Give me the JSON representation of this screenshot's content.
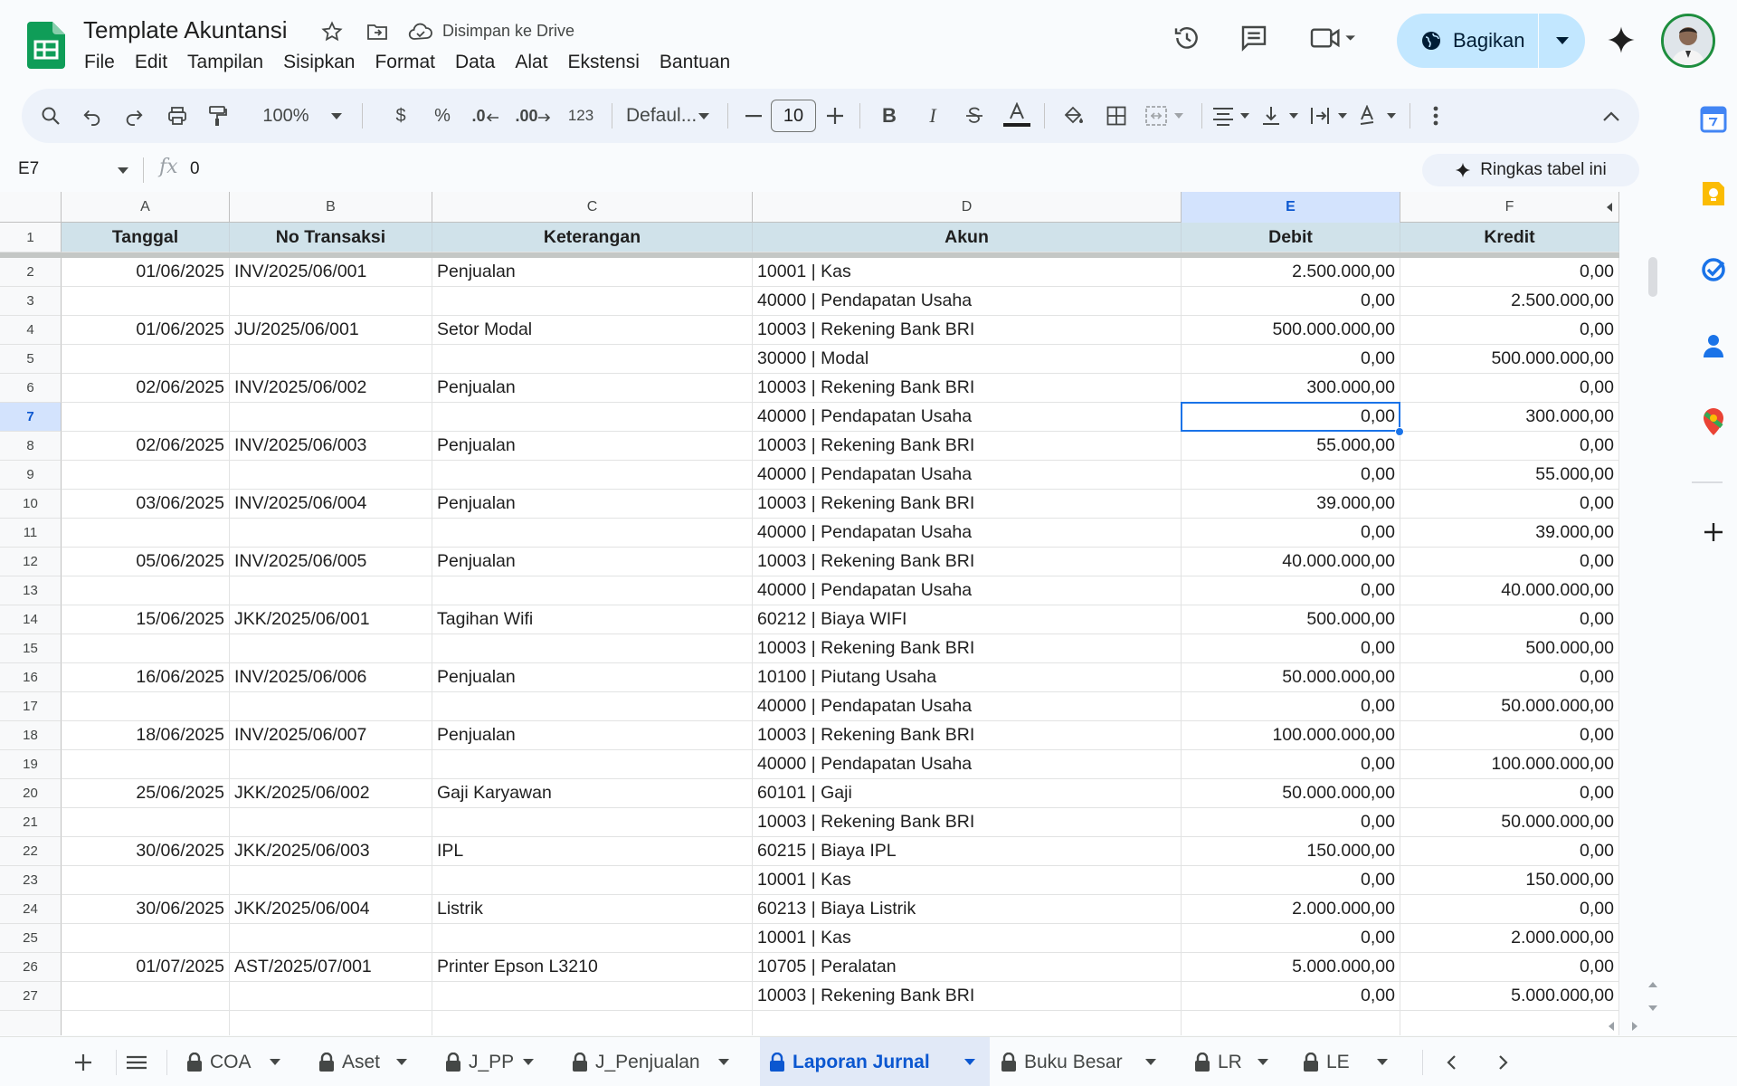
{
  "app": {
    "title": "Template Akuntansi",
    "saved_status": "Disimpan ke Drive",
    "menu": [
      "File",
      "Edit",
      "Tampilan",
      "Sisipkan",
      "Format",
      "Data",
      "Alat",
      "Ekstensi",
      "Bantuan"
    ],
    "share_label": "Bagikan"
  },
  "toolbar": {
    "zoom": "100%",
    "currency": "$",
    "percent": "%",
    "dec_decrease": ".0",
    "dec_increase": ".00",
    "number_format": "123",
    "font": "Defaul...",
    "font_size": "10"
  },
  "formula_bar": {
    "name_box": "E7",
    "fx": "fx",
    "value": "0",
    "summarize_label": "Ringkas tabel ini"
  },
  "grid": {
    "columns": [
      "A",
      "B",
      "C",
      "D",
      "E",
      "F"
    ],
    "selected_column": "E",
    "selected_row": "7",
    "header_row": {
      "num": "1",
      "cells": [
        "Tanggal",
        "No Transaksi",
        "Keterangan",
        "Akun",
        "Debit",
        "Kredit"
      ]
    },
    "rows": [
      {
        "num": "2",
        "cells": [
          "01/06/2025",
          "INV/2025/06/001",
          "Penjualan",
          "10001 | Kas",
          "2.500.000,00",
          "0,00"
        ]
      },
      {
        "num": "3",
        "cells": [
          "",
          "",
          "",
          "40000 | Pendapatan Usaha",
          "0,00",
          "2.500.000,00"
        ]
      },
      {
        "num": "4",
        "cells": [
          "01/06/2025",
          "JU/2025/06/001",
          "Setor Modal",
          "10003 | Rekening Bank BRI",
          "500.000.000,00",
          "0,00"
        ]
      },
      {
        "num": "5",
        "cells": [
          "",
          "",
          "",
          "30000 | Modal",
          "0,00",
          "500.000.000,00"
        ]
      },
      {
        "num": "6",
        "cells": [
          "02/06/2025",
          "INV/2025/06/002",
          "Penjualan",
          "10003 | Rekening Bank BRI",
          "300.000,00",
          "0,00"
        ]
      },
      {
        "num": "7",
        "cells": [
          "",
          "",
          "",
          "40000 | Pendapatan Usaha",
          "0,00",
          "300.000,00"
        ]
      },
      {
        "num": "8",
        "cells": [
          "02/06/2025",
          "INV/2025/06/003",
          "Penjualan",
          "10003 | Rekening Bank BRI",
          "55.000,00",
          "0,00"
        ]
      },
      {
        "num": "9",
        "cells": [
          "",
          "",
          "",
          "40000 | Pendapatan Usaha",
          "0,00",
          "55.000,00"
        ]
      },
      {
        "num": "10",
        "cells": [
          "03/06/2025",
          "INV/2025/06/004",
          "Penjualan",
          "10003 | Rekening Bank BRI",
          "39.000,00",
          "0,00"
        ]
      },
      {
        "num": "11",
        "cells": [
          "",
          "",
          "",
          "40000 | Pendapatan Usaha",
          "0,00",
          "39.000,00"
        ]
      },
      {
        "num": "12",
        "cells": [
          "05/06/2025",
          "INV/2025/06/005",
          "Penjualan",
          "10003 | Rekening Bank BRI",
          "40.000.000,00",
          "0,00"
        ]
      },
      {
        "num": "13",
        "cells": [
          "",
          "",
          "",
          "40000 | Pendapatan Usaha",
          "0,00",
          "40.000.000,00"
        ]
      },
      {
        "num": "14",
        "cells": [
          "15/06/2025",
          "JKK/2025/06/001",
          "Tagihan Wifi",
          "60212 | Biaya WIFI",
          "500.000,00",
          "0,00"
        ]
      },
      {
        "num": "15",
        "cells": [
          "",
          "",
          "",
          "10003 | Rekening Bank BRI",
          "0,00",
          "500.000,00"
        ]
      },
      {
        "num": "16",
        "cells": [
          "16/06/2025",
          "INV/2025/06/006",
          "Penjualan",
          "10100 | Piutang Usaha",
          "50.000.000,00",
          "0,00"
        ]
      },
      {
        "num": "17",
        "cells": [
          "",
          "",
          "",
          "40000 | Pendapatan Usaha",
          "0,00",
          "50.000.000,00"
        ]
      },
      {
        "num": "18",
        "cells": [
          "18/06/2025",
          "INV/2025/06/007",
          "Penjualan",
          "10003 | Rekening Bank BRI",
          "100.000.000,00",
          "0,00"
        ]
      },
      {
        "num": "19",
        "cells": [
          "",
          "",
          "",
          "40000 | Pendapatan Usaha",
          "0,00",
          "100.000.000,00"
        ]
      },
      {
        "num": "20",
        "cells": [
          "25/06/2025",
          "JKK/2025/06/002",
          "Gaji Karyawan",
          "60101 | Gaji",
          "50.000.000,00",
          "0,00"
        ]
      },
      {
        "num": "21",
        "cells": [
          "",
          "",
          "",
          "10003 | Rekening Bank BRI",
          "0,00",
          "50.000.000,00"
        ]
      },
      {
        "num": "22",
        "cells": [
          "30/06/2025",
          "JKK/2025/06/003",
          "IPL",
          "60215 | Biaya IPL",
          "150.000,00",
          "0,00"
        ]
      },
      {
        "num": "23",
        "cells": [
          "",
          "",
          "",
          "10001 | Kas",
          "0,00",
          "150.000,00"
        ]
      },
      {
        "num": "24",
        "cells": [
          "30/06/2025",
          "JKK/2025/06/004",
          "Listrik",
          "60213 | Biaya Listrik",
          "2.000.000,00",
          "0,00"
        ]
      },
      {
        "num": "25",
        "cells": [
          "",
          "",
          "",
          "10001 | Kas",
          "0,00",
          "2.000.000,00"
        ]
      },
      {
        "num": "26",
        "cells": [
          "01/07/2025",
          "AST/2025/07/001",
          "Printer Epson L3210",
          "10705 | Peralatan",
          "5.000.000,00",
          "0,00"
        ]
      },
      {
        "num": "27",
        "cells": [
          "",
          "",
          "",
          "10003 | Rekening Bank BRI",
          "0,00",
          "5.000.000,00"
        ]
      }
    ]
  },
  "sheet_tabs": [
    {
      "label": "COA",
      "active": false
    },
    {
      "label": "Aset",
      "active": false
    },
    {
      "label": "J_PP",
      "active": false
    },
    {
      "label": "J_Penjualan",
      "active": false
    },
    {
      "label": "Laporan Jurnal",
      "active": true
    },
    {
      "label": "Buku Besar",
      "active": false
    },
    {
      "label": "LR",
      "active": false
    },
    {
      "label": "LE",
      "active": false
    }
  ],
  "colors": {
    "accent": "#1a73e8",
    "header_fill": "#d0e2ea",
    "share_bg": "#c2e7ff",
    "active_tab": "#0b57d0",
    "sheets_green": "#0f9d58"
  }
}
